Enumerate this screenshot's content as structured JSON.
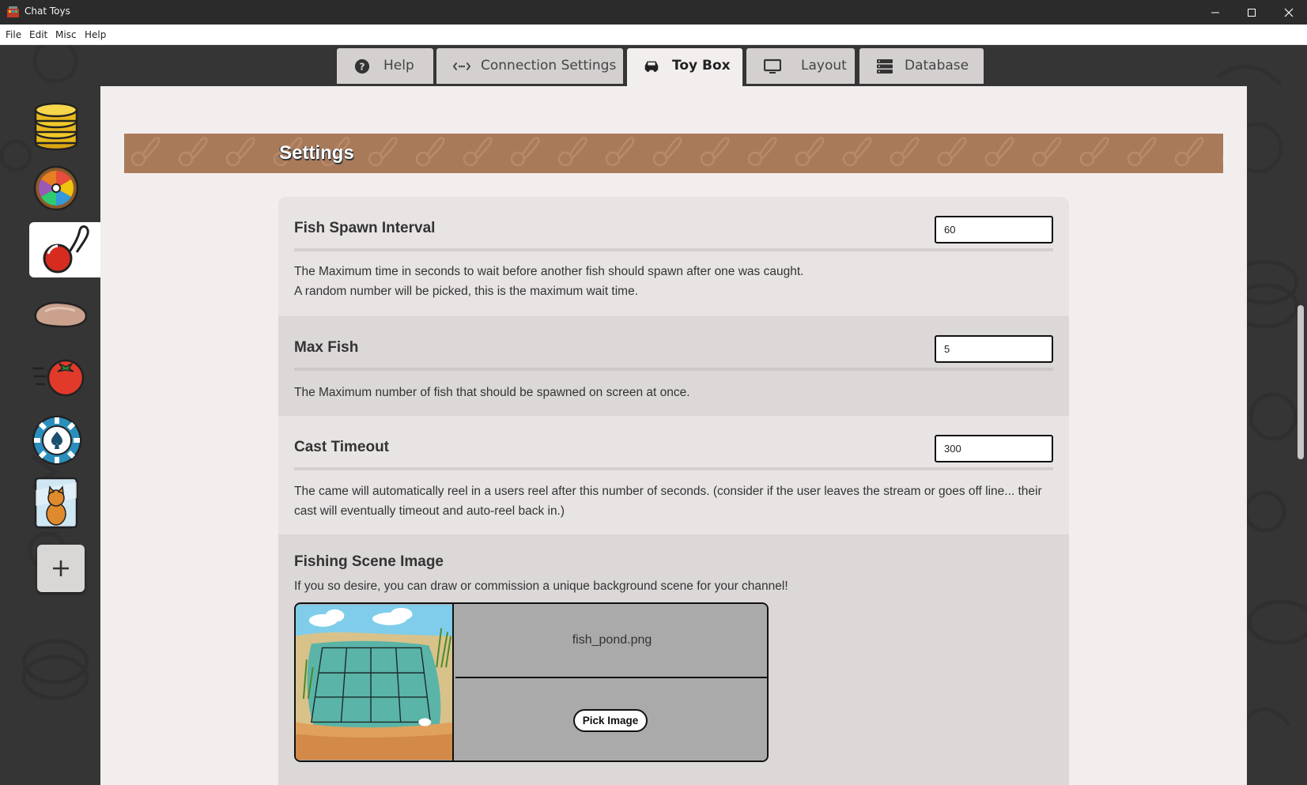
{
  "window": {
    "title": "Chat Toys"
  },
  "menubar": {
    "items": [
      "File",
      "Edit",
      "Misc",
      "Help"
    ]
  },
  "tabs": [
    {
      "label": "Help",
      "icon": "question-circle-icon"
    },
    {
      "label": "Connection Settings",
      "icon": "connection-arrows-icon"
    },
    {
      "label": "Toy Box",
      "icon": "car-icon",
      "active": true
    },
    {
      "label": "Layout",
      "icon": "monitor-icon"
    },
    {
      "label": "Database",
      "icon": "database-icon"
    }
  ],
  "sidebar": {
    "items": [
      {
        "icon": "coin-stack-icon"
      },
      {
        "icon": "prize-wheel-icon"
      },
      {
        "icon": "fishing-bobber-icon",
        "active": true
      },
      {
        "icon": "rock-icon"
      },
      {
        "icon": "flying-tomato-icon"
      },
      {
        "icon": "poker-chip-icon"
      },
      {
        "icon": "cat-card-icon"
      }
    ],
    "add_icon": "plus-icon"
  },
  "settings": {
    "title": "Settings",
    "fish_spawn_interval": {
      "title": "Fish Spawn Interval",
      "value": "60",
      "description_line1": "The Maximum time in seconds to wait before another fish should spawn after one was caught.",
      "description_line2": "A random number will be picked, this is the maximum wait time."
    },
    "max_fish": {
      "title": "Max Fish",
      "value": "5",
      "description": "The Maximum number of fish that should be spawned on screen at once."
    },
    "cast_timeout": {
      "title": "Cast Timeout",
      "value": "300",
      "description": "The came will automatically reel in a users reel after this number of seconds. (consider if the user leaves the stream or goes off line... their cast will eventually timeout and auto-reel back in.)"
    },
    "fishing_scene_image": {
      "title": "Fishing Scene Image",
      "description": "If you so desire, you can draw or commission a unique background scene for your channel!",
      "filename": "fish_pond.png",
      "pick_button": "Pick Image"
    }
  },
  "colors": {
    "banner": "#a97a5a",
    "panel": "#f3eeee",
    "card": "#e8e4e4",
    "card_alt": "#dcd8d8",
    "titlebar": "#2b2b2b"
  }
}
